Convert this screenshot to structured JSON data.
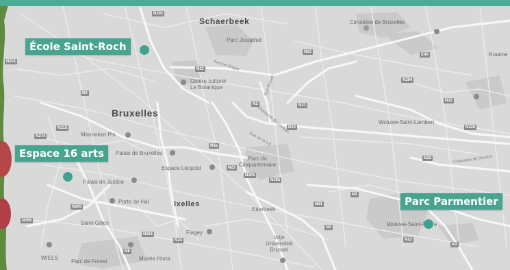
{
  "map": {
    "cities": {
      "schaerbeek": "Schaerbeek",
      "bruxelles": "Bruxelles",
      "ixelles": "Ixelles"
    },
    "districts": {
      "etterbeek": "Etterbeek",
      "saint_gilles": "Saint-Gilles",
      "wiels": "WIELS",
      "woluwe_saint_lambert": "Woluwe-Saint-Lambert",
      "woluwe_saint_pierre": "Woluwe-Saint-Pierre",
      "parc_de_forest": "Parc de Forest",
      "kraainem": "Kraaine"
    },
    "places": {
      "parc_josaphat": "Parc Josaphat",
      "cimetiere": "Cimetière de Bruxelles",
      "centre_culturel_line1": "Centre culturel",
      "centre_culturel_line2": "Le Botanique",
      "manneken_pis": "Manneken Pis",
      "palais_bruxelles": "Palais de Bruxelles",
      "espace_leopold": "Espace Léopold",
      "palais_justice": "Palais de Justice",
      "porte_de_hal": "Porte de Hal",
      "parc_cinquantenaire_line1": "Parc du",
      "parc_cinquantenaire_line2": "Cinquantenaire",
      "flagey": "Flagey",
      "vub_line1": "Vrije",
      "vub_line2": "Universiteit",
      "vub_line3": "Brussel",
      "musee_horta": "Musée Horta"
    },
    "streets": {
      "avenue_rogier": "Avenue Rogier",
      "rue_royale": "Rue Royale",
      "chaussee_louvain": "Chaussée de Louvain",
      "rue_loi": "Rue de la Loi",
      "chaussee_stockel": "Chaussée de Stockel"
    },
    "roads": [
      "N201",
      "N22",
      "E40",
      "N2",
      "N21",
      "N294",
      "N22",
      "N21",
      "N23",
      "N226",
      "N274",
      "N215",
      "N3a",
      "N23",
      "N205",
      "N295",
      "N22",
      "N21",
      "N3",
      "N265",
      "N266",
      "N261",
      "N24",
      "N3",
      "N8",
      "N22",
      "N3",
      "N201",
      "N3"
    ]
  },
  "locations": [
    {
      "name": "École Saint-Roch"
    },
    {
      "name": "Espace 16 arts"
    },
    {
      "name": "Parc Parmentier"
    }
  ],
  "colors": {
    "label_bg": "#48a48f",
    "marker": "#3fa28f",
    "top_bar": "#4eab97",
    "map_bg": "#d8d8d8"
  }
}
